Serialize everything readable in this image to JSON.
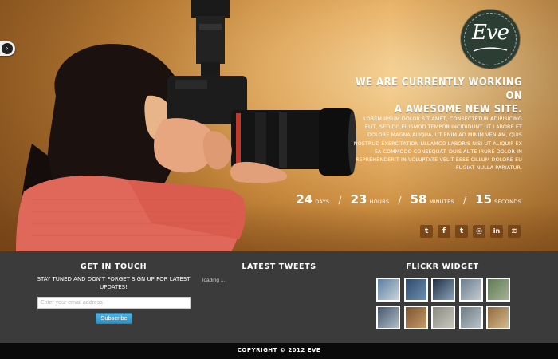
{
  "hero": {
    "headline_line1": "We are currently working on",
    "headline_line2": "a awesome new site.",
    "description": "Lorem ipsum dolor sit amet, consectetur adipisicing elit, sed do eiusmod tempor incididunt ut labore et dolore magna aliqua. Ut enim ad minim veniam, quis nostrud exercitation ullamco laboris nisi ut aliquip ex ea commodo consequat. Duis aute irure dolor in reprehenderit in voluptate velit esse cillum dolore eu fugiat nulla pariatur.",
    "photo": "girl-with-camera-photo"
  },
  "logo": {
    "text": "Eve",
    "bg_color": "#2c3e34"
  },
  "countdown": {
    "days": {
      "value": "24",
      "label": "days"
    },
    "hours": {
      "value": "23",
      "label": "hours"
    },
    "minutes": {
      "value": "58",
      "label": "minutes"
    },
    "seconds": {
      "value": "15",
      "label": "seconds"
    },
    "separator": "/"
  },
  "social": {
    "twitter": {
      "icon": "twitter-icon",
      "glyph": "t"
    },
    "facebook": {
      "icon": "facebook-icon",
      "glyph": "f"
    },
    "tumblr": {
      "icon": "tumblr-icon",
      "glyph": "t"
    },
    "dribbble": {
      "icon": "dribbble-icon",
      "glyph": "◎"
    },
    "linkedin": {
      "icon": "linkedin-icon",
      "glyph": "in"
    },
    "rss": {
      "icon": "rss-icon",
      "glyph": "≋"
    }
  },
  "get_in_touch": {
    "title": "Get In Touch",
    "text": "Stay tuned and don't forget sign up for latest updates!",
    "email_placeholder": "Enter your email address",
    "subscribe_label": "Subscribe"
  },
  "latest_tweets": {
    "title": "Latest Tweets",
    "status": "loading ..."
  },
  "flickr": {
    "title": "Flickr Widget",
    "thumbs": [
      {
        "colors": [
          "#5b7da0",
          "#c9d4dd"
        ]
      },
      {
        "colors": [
          "#2e4b6e",
          "#6f8fb0"
        ]
      },
      {
        "colors": [
          "#1f2f45",
          "#8ca2b8"
        ]
      },
      {
        "colors": [
          "#6b7d8c",
          "#c4ccd3"
        ]
      },
      {
        "colors": [
          "#5f7a55",
          "#a5b394"
        ]
      },
      {
        "colors": [
          "#44586c",
          "#b0bcc8"
        ]
      },
      {
        "colors": [
          "#7a5430",
          "#c79a66"
        ]
      },
      {
        "colors": [
          "#8a8a80",
          "#c8c8be"
        ]
      },
      {
        "colors": [
          "#6d7a82",
          "#b9c4ca"
        ]
      },
      {
        "colors": [
          "#8f6b3e",
          "#d6b98c"
        ]
      }
    ]
  },
  "footer": {
    "copyright": "Copyright © 2012 Eve"
  },
  "colors": {
    "footer_bg": "#3b3b3b",
    "copyright_bg": "#0a0a0a",
    "subscribe_blue": "#2a8fc4"
  }
}
